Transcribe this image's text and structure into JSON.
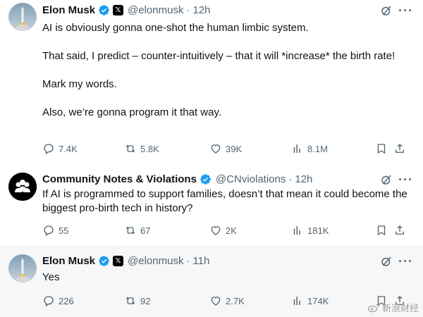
{
  "colors": {
    "verified_blue": "#1d9bf0",
    "muted_text": "#536471",
    "primary_text": "#0f1419",
    "reply_bg": "#f7f7f7"
  },
  "tweets": [
    {
      "author_name": "Elon Musk",
      "handle": "@elonmusk",
      "separator": "·",
      "time": "12h",
      "body": [
        "AI is obviously gonna one-shot the human limbic system.",
        "That said, I predict – counter-intuitively – that it will *increase* the birth rate!",
        "Mark my words.",
        "Also, we’re gonna program it that way."
      ],
      "stats": {
        "replies": "7.4K",
        "reposts": "5.8K",
        "likes": "39K",
        "views": "8.1M"
      },
      "icons": [
        "verified-badge",
        "x-affiliate-badge",
        "grok-icon",
        "more-icon"
      ]
    },
    {
      "author_name": "Community Notes & Violations",
      "handle": "@CNviolations",
      "separator": "·",
      "time": "12h",
      "body": [
        "If AI is programmed to support families, doesn’t that mean it could become the biggest pro-birth tech in history?"
      ],
      "stats": {
        "replies": "55",
        "reposts": "67",
        "likes": "2K",
        "views": "181K"
      },
      "icons": [
        "verified-badge",
        "grok-icon",
        "more-icon"
      ]
    },
    {
      "author_name": "Elon Musk",
      "handle": "@elonmusk",
      "separator": "·",
      "time": "11h",
      "body": [
        "Yes"
      ],
      "stats": {
        "replies": "226",
        "reposts": "92",
        "likes": "2.7K",
        "views": "174K"
      },
      "icons": [
        "verified-badge",
        "x-affiliate-badge",
        "grok-icon",
        "more-icon"
      ]
    }
  ],
  "watermark": {
    "text": "新浪财经"
  }
}
